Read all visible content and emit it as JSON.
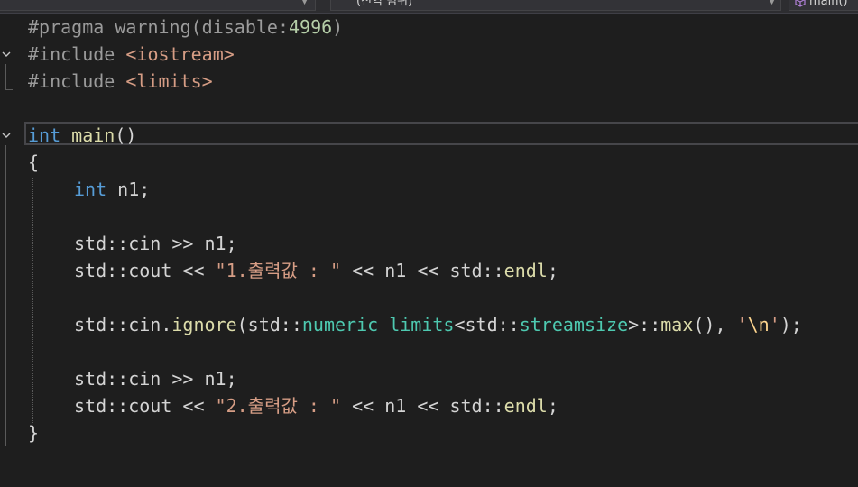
{
  "toolbar": {
    "project_dropdown": "",
    "scope_dropdown": "(전역 범위)",
    "member_dropdown": "main()"
  },
  "code_lines": [
    {
      "segments": [
        {
          "t": "#pragma warning(disable:",
          "c": "pre"
        },
        {
          "t": "4996",
          "c": "num"
        },
        {
          "t": ")",
          "c": "pre"
        }
      ]
    },
    {
      "segments": [
        {
          "t": "#include ",
          "c": "pre"
        },
        {
          "t": "<iostream>",
          "c": "str"
        }
      ]
    },
    {
      "segments": [
        {
          "t": "#include ",
          "c": "pre"
        },
        {
          "t": "<limits>",
          "c": "str"
        }
      ]
    },
    {
      "segments": []
    },
    {
      "segments": [
        {
          "t": "int",
          "c": "kw"
        },
        {
          "t": " ",
          "c": ""
        },
        {
          "t": "main",
          "c": "fn"
        },
        {
          "t": "()",
          "c": ""
        }
      ]
    },
    {
      "segments": [
        {
          "t": "{",
          "c": ""
        }
      ]
    },
    {
      "segments": [
        {
          "t": "int",
          "c": "kw"
        },
        {
          "t": " n1;",
          "c": ""
        }
      ]
    },
    {
      "segments": []
    },
    {
      "segments": [
        {
          "t": "std::cin >> n1;",
          "c": ""
        }
      ]
    },
    {
      "segments": [
        {
          "t": "std::cout << ",
          "c": ""
        },
        {
          "t": "\"1.출력값 : \"",
          "c": "str"
        },
        {
          "t": " << n1 << std::",
          "c": ""
        },
        {
          "t": "endl",
          "c": "fn"
        },
        {
          "t": ";",
          "c": ""
        }
      ]
    },
    {
      "segments": []
    },
    {
      "segments": [
        {
          "t": "std::cin.",
          "c": ""
        },
        {
          "t": "ignore",
          "c": "fn"
        },
        {
          "t": "(std::",
          "c": ""
        },
        {
          "t": "numeric_limits",
          "c": "ty"
        },
        {
          "t": "<std::",
          "c": ""
        },
        {
          "t": "streamsize",
          "c": "ty"
        },
        {
          "t": ">::",
          "c": ""
        },
        {
          "t": "max",
          "c": "fn"
        },
        {
          "t": "(), ",
          "c": ""
        },
        {
          "t": "'",
          "c": "str"
        },
        {
          "t": "\\n",
          "c": "esc"
        },
        {
          "t": "'",
          "c": "str"
        },
        {
          "t": ");",
          "c": ""
        }
      ]
    },
    {
      "segments": []
    },
    {
      "segments": [
        {
          "t": "std::cin >> n1;",
          "c": ""
        }
      ]
    },
    {
      "segments": [
        {
          "t": "std::cout << ",
          "c": ""
        },
        {
          "t": "\"2.출력값 : \"",
          "c": "str"
        },
        {
          "t": " << n1 << std::",
          "c": ""
        },
        {
          "t": "endl",
          "c": "fn"
        },
        {
          "t": ";",
          "c": ""
        }
      ]
    },
    {
      "segments": [
        {
          "t": "}",
          "c": ""
        }
      ]
    }
  ]
}
